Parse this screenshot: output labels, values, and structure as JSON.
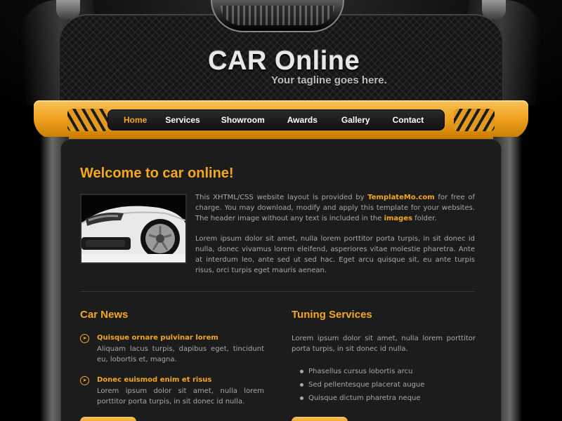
{
  "header": {
    "title": "CAR Online",
    "tagline": "Your tagline goes here."
  },
  "nav": {
    "items": [
      {
        "label": "Home",
        "active": true
      },
      {
        "label": "Services",
        "active": false
      },
      {
        "label": "Showroom",
        "active": false
      },
      {
        "label": "Awards",
        "active": false
      },
      {
        "label": "Gallery",
        "active": false
      },
      {
        "label": "Contact",
        "active": false
      }
    ]
  },
  "welcome": {
    "heading": "Welcome to car online!",
    "p1_pre": "This XHTML/CSS website layout is provided by ",
    "p1_link": "TemplateMo.com",
    "p1_mid": " for free of charge. You may download, modify and apply this template for your websites. The header image without any text is included in the ",
    "p1_images": "images",
    "p1_post": " folder.",
    "p2": "Lorem ipsum dolor sit amet, nulla lorem porttitor porta turpis, in sit donec id nulla, donec vivamus lorem eleifend, asperiores vitae molestie pharetra. Ante at interdum leo, ante sed ut sed hac. Eget arcu quisque sit, eu ante turpis risus, orci turpis eget mauris aenean."
  },
  "car_news": {
    "title": "Car News",
    "items": [
      {
        "heading": "Quisque ornare pulvinar lorem",
        "body": "Aliquam lacus turpis, dapibus eget, tincidunt eu, lobortis et, magna."
      },
      {
        "heading": "Donec euismod enim et risus",
        "body": "Lorem ipsum dolor sit amet, nulla lorem porttitor porta turpis, in sit donec id nulla."
      }
    ]
  },
  "tuning": {
    "title": "Tuning Services",
    "text": "Lorem ipsum dolor sit amet, nulla lorem porttitor porta turpis, in sit donec id nulla.",
    "list": [
      "Phasellus cursus lobortis arcu",
      "Sed pellentesque placerat augue",
      "Quisque dictum pharetra neque"
    ]
  },
  "colors": {
    "accent": "#f5a81e",
    "background": "#000000",
    "panel": "#1c1c1c",
    "text": "#a8a8a8"
  },
  "icons": {
    "news_bullet": "arrow-circle-icon"
  }
}
